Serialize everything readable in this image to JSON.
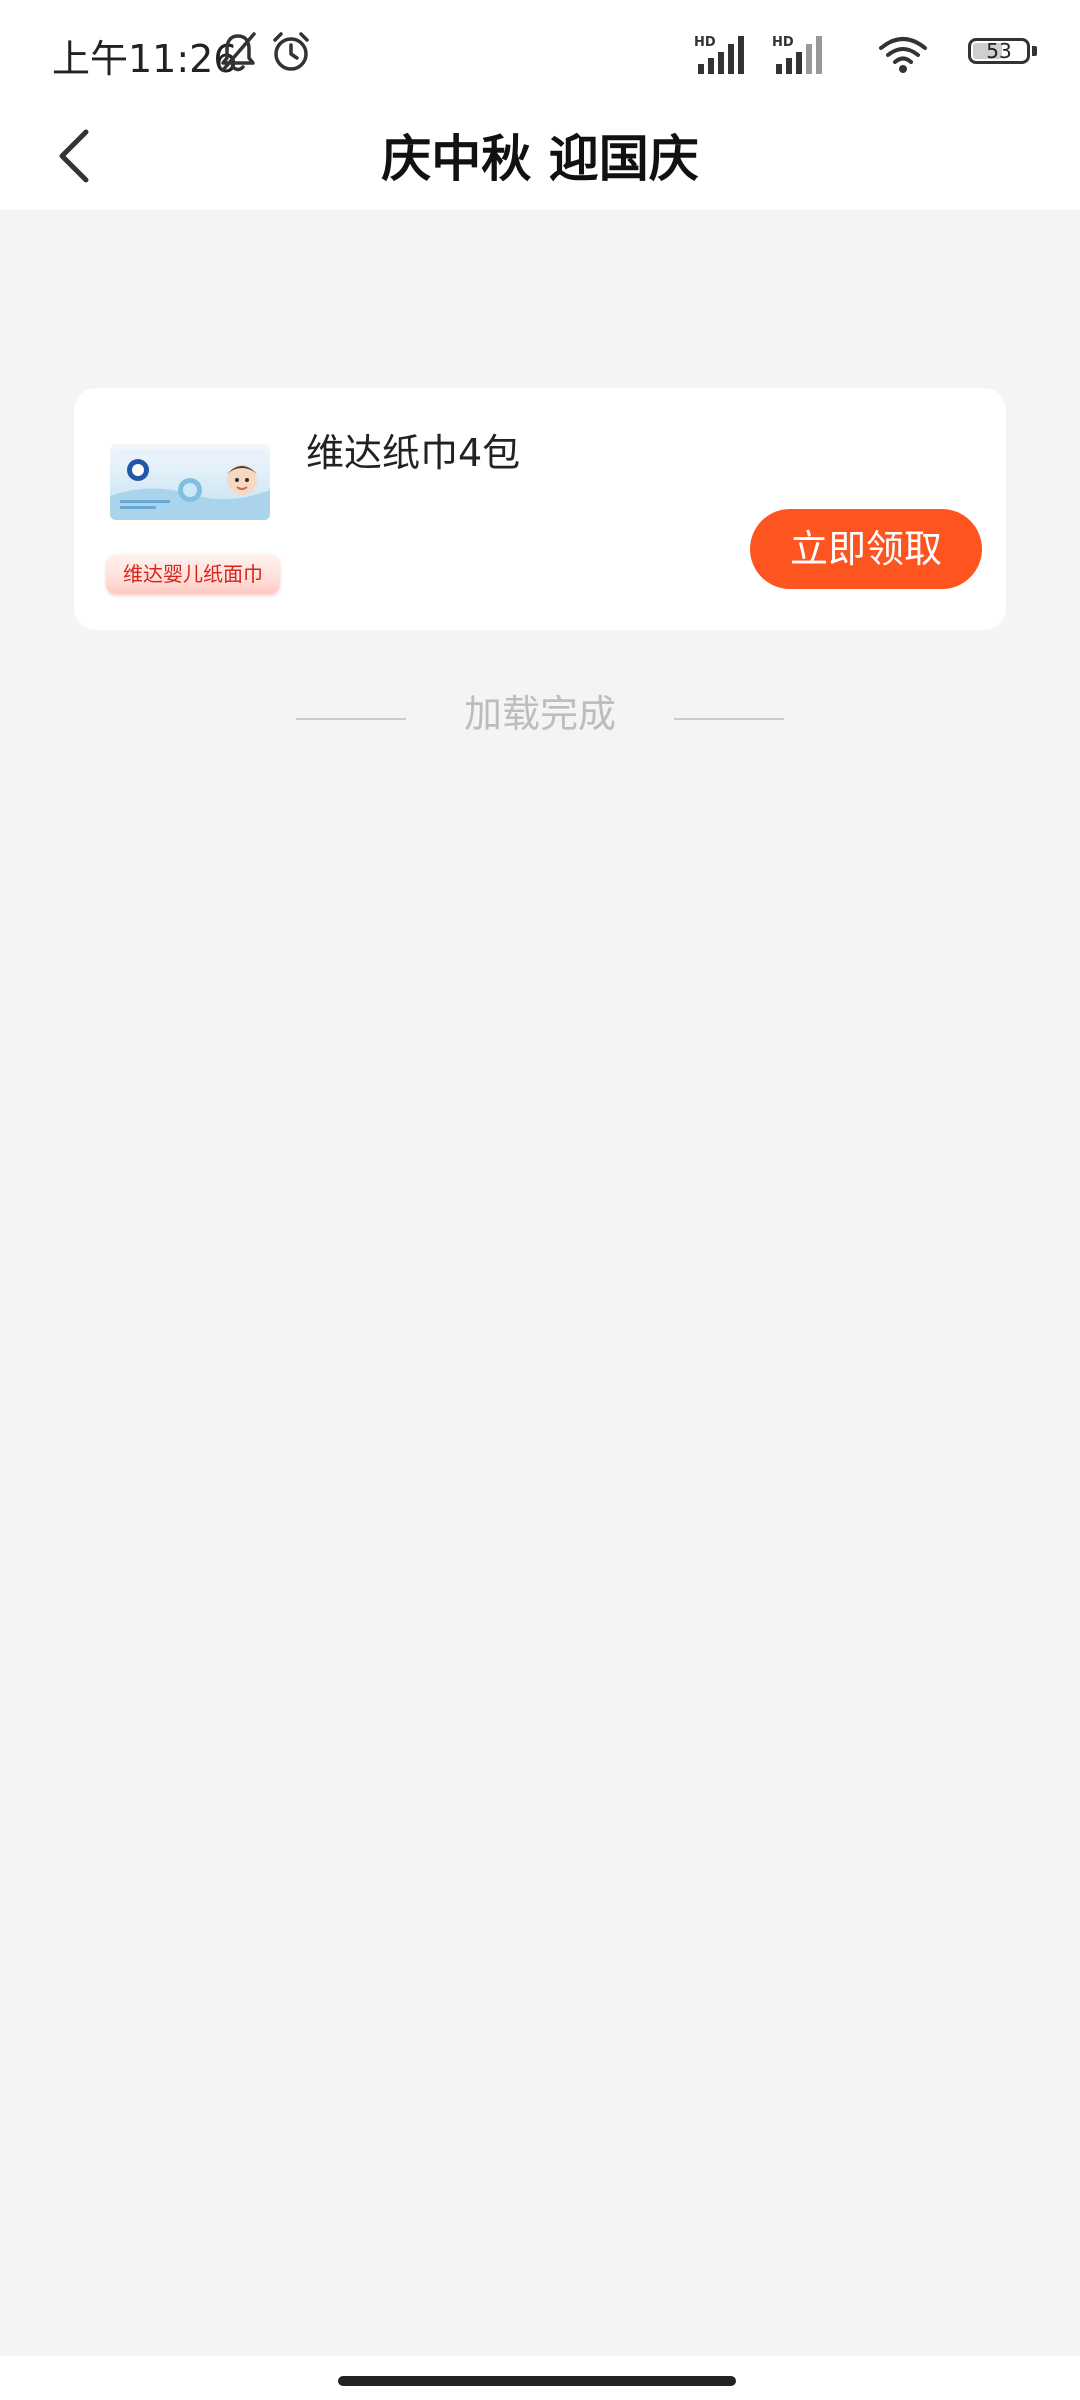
{
  "status_bar": {
    "time": "上午11:26",
    "signal_1_label": "HD",
    "signal_2_label": "HD",
    "battery": "53",
    "icons": [
      "bell-off-icon",
      "alarm-icon",
      "signal-icon",
      "signal-icon",
      "wifi-icon",
      "battery-icon"
    ]
  },
  "header": {
    "back_icon": "chevron-left-icon",
    "title": "庆中秋 迎国庆"
  },
  "product": {
    "name": "维达纸巾4包",
    "badge": "维达婴儿纸面巾",
    "claim_label": "立即领取"
  },
  "footer": {
    "loaded_text": "加载完成"
  },
  "colors": {
    "accent": "#fe5420",
    "page_background": "#f4f4f4",
    "card_background": "#ffffff",
    "badge_text": "#d8241a",
    "muted_text": "#bdbdbd"
  }
}
